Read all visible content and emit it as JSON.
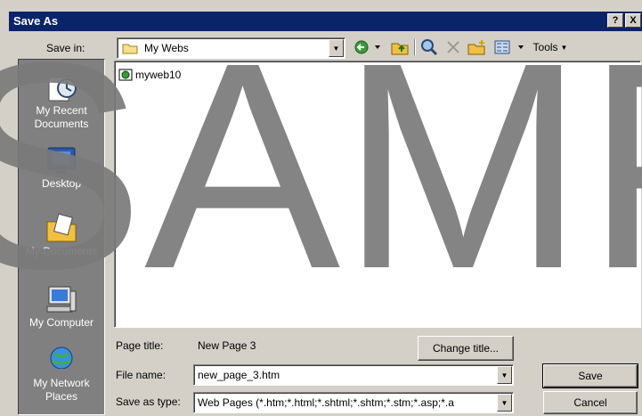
{
  "window": {
    "title": "Save As",
    "help_btn": "?",
    "close_btn": "X"
  },
  "toolbar": {
    "save_in_label": "Save in:",
    "save_in_value": "My Webs",
    "tools_label": "Tools"
  },
  "places": [
    {
      "label_line1": "My Recent",
      "label_line2": "Documents",
      "icon": "recent-documents-icon"
    },
    {
      "label_line1": "Desktop",
      "label_line2": "",
      "icon": "desktop-icon"
    },
    {
      "label_line1": "My Documents",
      "label_line2": "",
      "icon": "my-documents-icon"
    },
    {
      "label_line1": "My Computer",
      "label_line2": "",
      "icon": "my-computer-icon"
    },
    {
      "label_line1": "My Network",
      "label_line2": "Places",
      "icon": "network-places-icon"
    }
  ],
  "files": [
    {
      "name": "myweb10",
      "icon": "web-folder-icon"
    }
  ],
  "form": {
    "page_title_label": "Page title:",
    "page_title_value": "New Page 3",
    "change_title_btn": "Change title...",
    "file_name_label": "File name:",
    "file_name_value": "new_page_3.htm",
    "save_as_type_label": "Save as type:",
    "save_as_type_value": "Web Pages (*.htm;*.html;*.shtml;*.shtm;*.stm;*.asp;*.a"
  },
  "buttons": {
    "save": "Save",
    "cancel": "Cancel"
  },
  "watermark": "SAMP",
  "colors": {
    "titlebar": "#0a246a",
    "face": "#d4d0c8",
    "places_bg": "#808080",
    "watermark": "#7a7a7a"
  }
}
